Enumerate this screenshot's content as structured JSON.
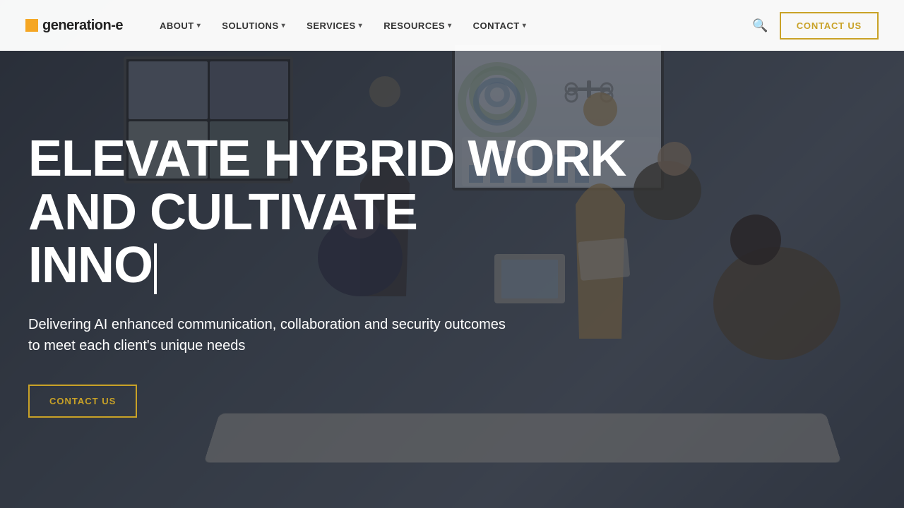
{
  "brand": {
    "logo_text": "generation-e",
    "logo_square_color": "#f5a623"
  },
  "nav": {
    "items": [
      {
        "label": "ABOUT",
        "has_dropdown": true
      },
      {
        "label": "SOLUTIONS",
        "has_dropdown": true
      },
      {
        "label": "SERVICES",
        "has_dropdown": true
      },
      {
        "label": "RESOURCES",
        "has_dropdown": true
      },
      {
        "label": "CONTACT",
        "has_dropdown": true
      }
    ],
    "contact_us_button": "CONTACT US"
  },
  "hero": {
    "headline_line1": "ELEVATE HYBRID WORK",
    "headline_line2": "AND CULTIVATE",
    "headline_line3": "INNO",
    "subtitle": "Delivering AI enhanced communication, collaboration and security outcomes to meet each client's unique needs",
    "cta_label": "CONTACT US"
  }
}
